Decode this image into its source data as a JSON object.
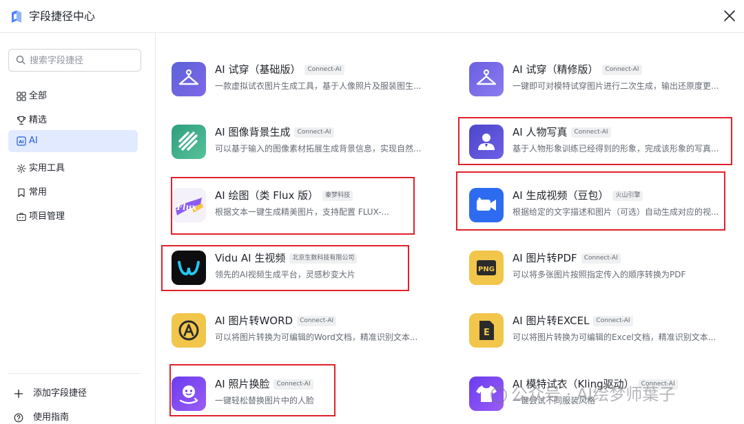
{
  "header": {
    "title": "字段捷径中心"
  },
  "search": {
    "placeholder": "搜索字段捷径"
  },
  "nav": [
    {
      "label": "全部"
    },
    {
      "label": "精选"
    },
    {
      "label": "AI"
    },
    {
      "label": "实用工具"
    },
    {
      "label": "常用"
    },
    {
      "label": "项目管理"
    }
  ],
  "footer": {
    "add_label": "添加字段捷径",
    "guide_label": "使用指南"
  },
  "cards": [
    {
      "title": "AI 试穿（基础版）",
      "tag": "Connect-AI",
      "desc": "一款虚拟试衣图片生成工具，基于人像照片及服装图生..."
    },
    {
      "title": "AI 试穿（精修版）",
      "tag": "Connect-AI",
      "desc": "一键即可对模特试穿图片进行二次生成，输出还原度更..."
    },
    {
      "title": "AI 图像背景生成",
      "tag": "Connect-AI",
      "desc": "可以基于输入的图像素材拓展生成背景信息，实现自然..."
    },
    {
      "title": "AI 人物写真",
      "tag": "Connect-AI",
      "desc": "基于人物形象训练已经得到的形象，完成该形象的写真..."
    },
    {
      "title": "AI 绘图（类 Flux 版）",
      "tag": "秦梦科技",
      "desc": "根据文本一键生成精美图片，支持配置 FLUX-...",
      "icon_text": "Flux"
    },
    {
      "title": "AI 生成视频（豆包）",
      "tag": "火山引擎",
      "desc": "根据给定的文字描述和图片（可选）自动生成对应的视..."
    },
    {
      "title": "Vidu AI 生视频",
      "tag": "北京生数科技有限公司",
      "desc": "领先的AI视频生成平台，灵感秒变大片"
    },
    {
      "title": "AI 图片转PDF",
      "tag": "Connect-AI",
      "desc": "可以将多张图片按照指定传入的顺序转换为PDF",
      "icon_text": "PNG"
    },
    {
      "title": "AI 图片转WORD",
      "tag": "Connect-AI",
      "desc": "可以将图片转换为可编辑的Word文档，精准识别文本..."
    },
    {
      "title": "AI 图片转EXCEL",
      "tag": "Connect-AI",
      "desc": "可以将图片转换为可编辑的Excel文档，精准识别文本...",
      "icon_text": "E"
    },
    {
      "title": "AI 照片换脸",
      "tag": "Connect-AI",
      "desc": "一键轻松替换图片中的人脸"
    },
    {
      "title": "AI 模特试衣（Kling驱动）",
      "tag": "Connect-AI",
      "desc": "一键尝试不同服装风格"
    }
  ],
  "watermark": {
    "text": "公众号 · AI绘梦师葉子"
  },
  "colors": {
    "accent": "#245bdb",
    "active_bg": "#e1eaff",
    "highlight": "#e0202a"
  }
}
